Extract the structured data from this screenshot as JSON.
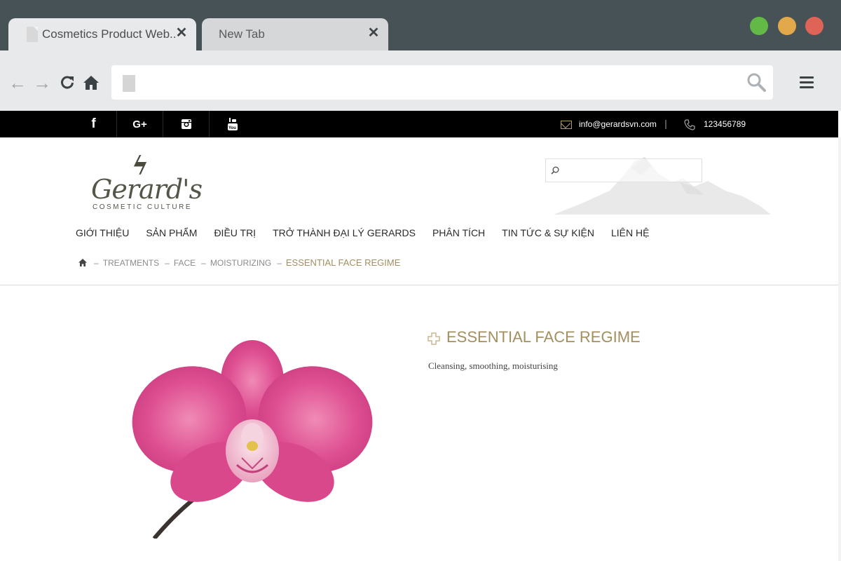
{
  "browser": {
    "tabs": [
      {
        "title": "Cosmetics Product Web..",
        "active": true
      },
      {
        "title": "New Tab",
        "active": false
      }
    ],
    "close_glyph": "✕",
    "url": "",
    "nav_icons": {
      "back": "←",
      "forward": "→",
      "reload": "↻",
      "home": "⌂"
    },
    "traffic_lights": {
      "green": "#63b945",
      "yellow": "#e2a94b",
      "red": "#e06358"
    }
  },
  "site": {
    "topbar": {
      "socials": [
        {
          "name": "facebook",
          "glyph": "f"
        },
        {
          "name": "google-plus",
          "glyph": "G+"
        },
        {
          "name": "instagram",
          "glyph": ""
        },
        {
          "name": "youtube",
          "glyph": ""
        }
      ],
      "email": "info@gerardsvn.com",
      "phone": "123456789"
    },
    "logo": {
      "name": "Gerard's",
      "tagline": "COSMETIC CULTURE"
    },
    "search": {
      "placeholder": ""
    },
    "nav": [
      "GIỚI THIỆU",
      "SẢN PHẨM",
      "ĐIỀU TRỊ",
      "TRỞ THÀNH ĐẠI LÝ GERARDS",
      "PHÂN TÍCH",
      "TIN TỨC & SỰ KIỆN",
      "LIÊN HỆ"
    ],
    "breadcrumb": {
      "items": [
        "TREATMENTS",
        "FACE",
        "MOISTURIZING"
      ],
      "current": "ESSENTIAL FACE REGIME",
      "separator": "–"
    },
    "product": {
      "title": "ESSENTIAL FACE REGIME",
      "description": "Cleansing, smoothing, moisturising"
    },
    "colors": {
      "accent": "#a38f5f",
      "topbar_bg": "#000000",
      "orchid": "#d94d8f"
    }
  }
}
